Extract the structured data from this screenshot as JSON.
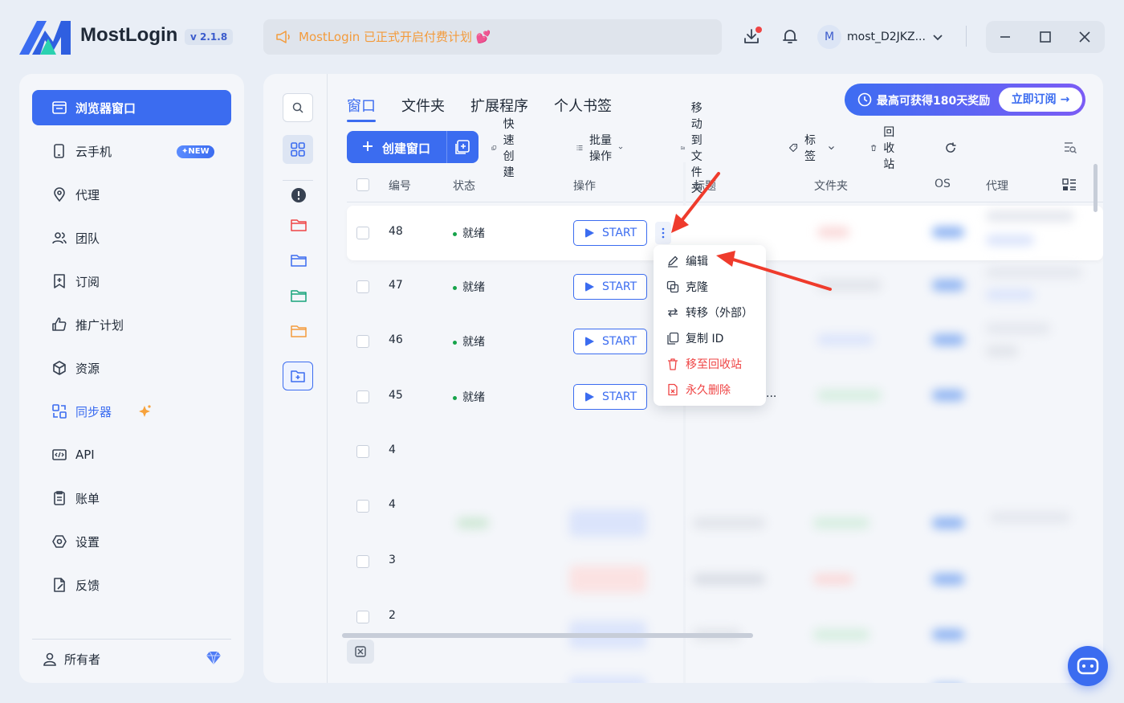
{
  "app": {
    "brand": "MostLogin",
    "version": "v 2.1.8",
    "announcement": "MostLogin 已正式开启付费计划 💕",
    "account_initial": "M",
    "account_name": "most_D2JKZ..."
  },
  "sidebar": {
    "items": [
      {
        "label": "浏览器窗口",
        "icon": "browser-window-icon"
      },
      {
        "label": "云手机",
        "icon": "cloud-phone-icon",
        "badge": "✦NEW"
      },
      {
        "label": "代理",
        "icon": "proxy-icon"
      },
      {
        "label": "团队",
        "icon": "team-icon"
      },
      {
        "label": "订阅",
        "icon": "subscription-icon"
      },
      {
        "label": "推广计划",
        "icon": "thumbs-up-icon"
      },
      {
        "label": "资源",
        "icon": "cube-icon"
      },
      {
        "label": "同步器",
        "icon": "sync-icon"
      },
      {
        "label": "API",
        "icon": "api-icon"
      },
      {
        "label": "账单",
        "icon": "bill-icon"
      },
      {
        "label": "设置",
        "icon": "settings-icon"
      },
      {
        "label": "反馈",
        "icon": "feedback-icon"
      }
    ],
    "owner": "所有者"
  },
  "tabs": [
    "窗口",
    "文件夹",
    "扩展程序",
    "个人书签"
  ],
  "promo": {
    "text": "最高可获得180天奖励",
    "button": "立即订阅"
  },
  "toolbar": {
    "create": "创建窗口",
    "quick_create": "快速创建",
    "batch": "批量操作",
    "move_folder": "移动到文件夹",
    "tags": "标签",
    "recycle": "回收站"
  },
  "table": {
    "headers": [
      "编号",
      "状态",
      "操作",
      "标题",
      "文件夹",
      "OS",
      "代理"
    ],
    "rows": [
      {
        "id": "48",
        "status": "就绪",
        "action": "START"
      },
      {
        "id": "47",
        "status": "就绪",
        "action": "START"
      },
      {
        "id": "46",
        "status": "就绪",
        "action": "START"
      },
      {
        "id": "45",
        "status": "就绪",
        "action": "START"
      },
      {
        "id": "4",
        "status": "",
        "action": ""
      },
      {
        "id": "4",
        "status": "",
        "action": ""
      },
      {
        "id": "3",
        "status": "",
        "action": ""
      },
      {
        "id": "2",
        "status": "",
        "action": ""
      }
    ],
    "truncated_title": "..."
  },
  "context_menu": {
    "items": [
      {
        "label": "编辑",
        "danger": false
      },
      {
        "label": "克隆",
        "danger": false
      },
      {
        "label": "转移（外部）",
        "danger": false
      },
      {
        "label": "复制 ID",
        "danger": false
      },
      {
        "label": "移至回收站",
        "danger": true
      },
      {
        "label": "永久删除",
        "danger": true
      }
    ]
  },
  "colors": {
    "accent": "#3b6cf0",
    "danger": "#ef4444",
    "ready": "#16a34a",
    "announce": "#f39b3c"
  }
}
